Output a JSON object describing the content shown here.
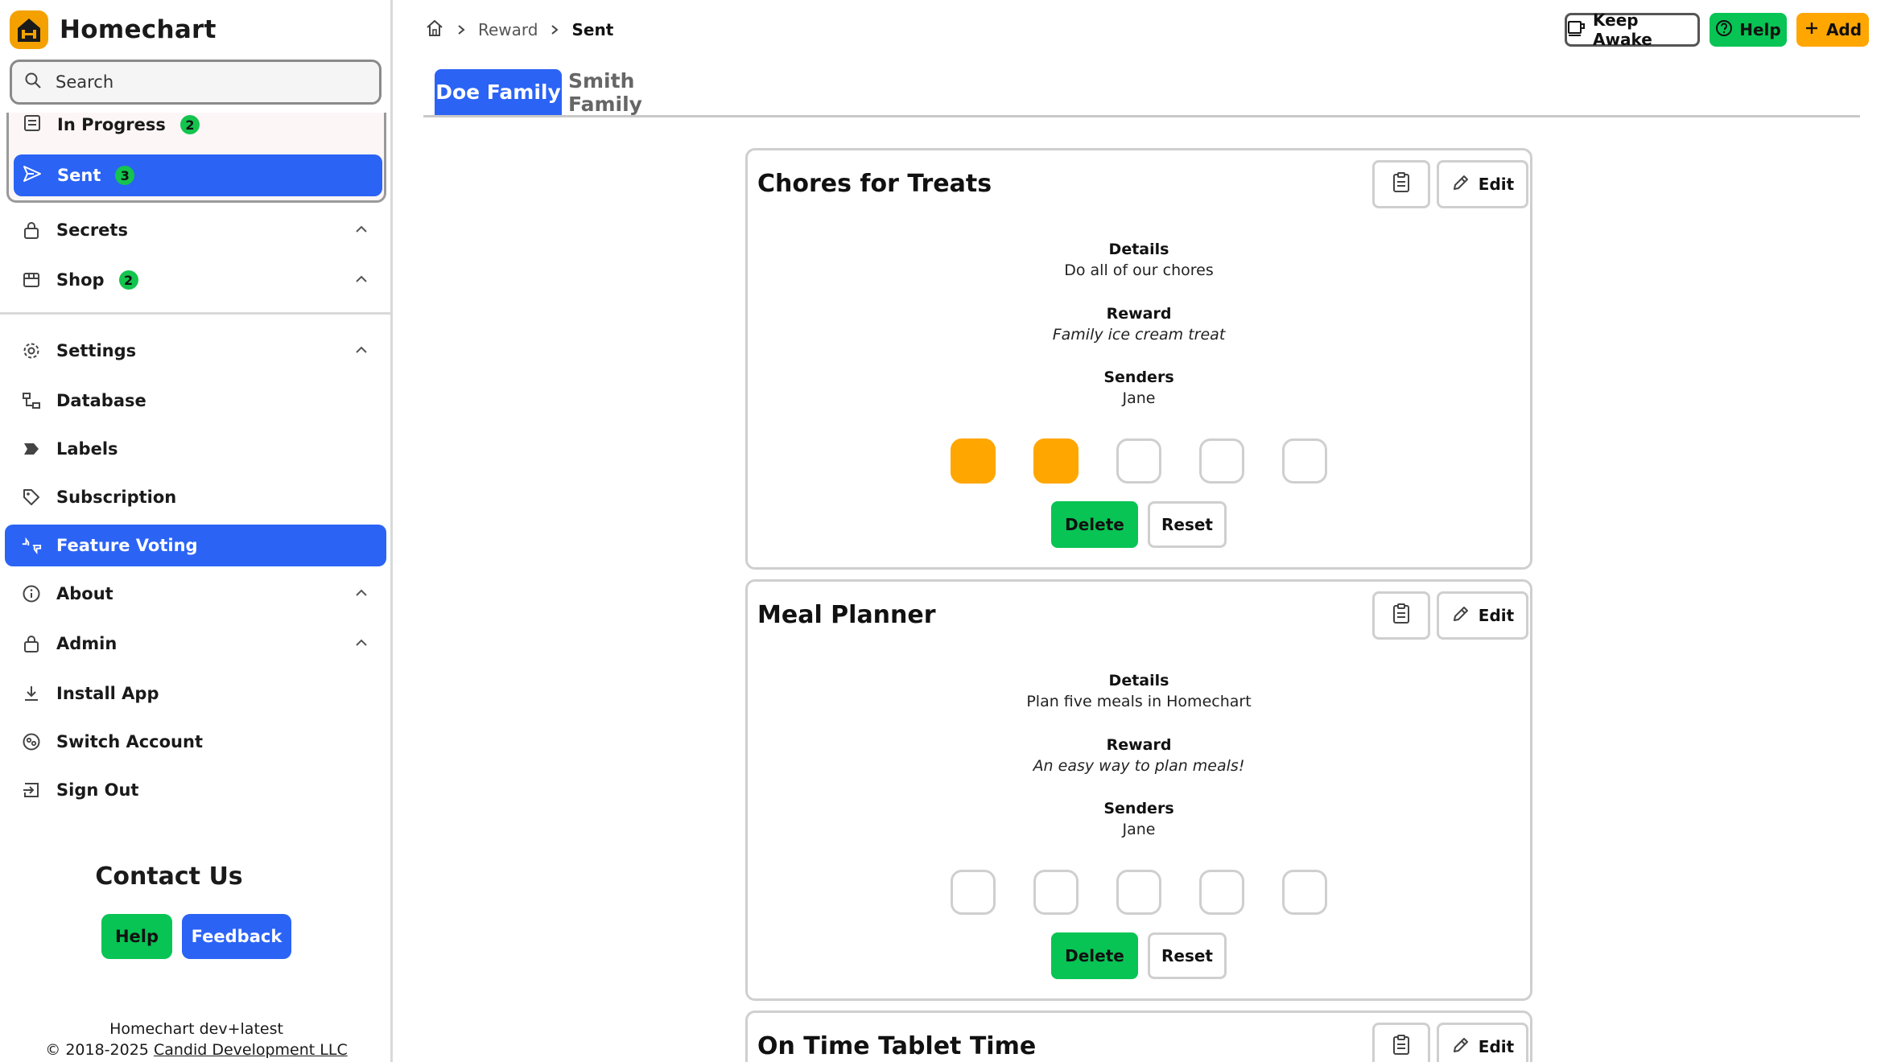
{
  "app": {
    "name": "Homechart",
    "logo_icon": "home-logo-icon",
    "accent": "#2b63f5",
    "warning": "#ffa600",
    "success": "#14c44e"
  },
  "search": {
    "placeholder": "Search"
  },
  "sidebar": {
    "sub_items": [
      {
        "label": "In Progress",
        "badge": "2",
        "icon": "list-icon"
      },
      {
        "label": "Sent",
        "badge": "3",
        "icon": "send-icon",
        "active": true
      }
    ],
    "items": [
      {
        "label": "Secrets",
        "icon": "lock-icon",
        "chevron": true
      },
      {
        "label": "Shop",
        "icon": "store-icon",
        "badge": "2",
        "chevron": true
      },
      {
        "label": "Settings",
        "icon": "gear-icon",
        "chevron": true
      },
      {
        "label": "Database",
        "icon": "database-icon"
      },
      {
        "label": "Labels",
        "icon": "label-icon"
      },
      {
        "label": "Subscription",
        "icon": "tag-icon"
      },
      {
        "label": "Feature Voting",
        "icon": "thumbs-icon",
        "active": true
      },
      {
        "label": "About",
        "icon": "info-icon",
        "chevron": true
      },
      {
        "label": "Admin",
        "icon": "lock-icon",
        "chevron": true
      },
      {
        "label": "Install App",
        "icon": "download-icon"
      },
      {
        "label": "Switch Account",
        "icon": "switch-account-icon"
      },
      {
        "label": "Sign Out",
        "icon": "sign-out-icon"
      }
    ]
  },
  "contact": {
    "title": "Contact Us",
    "help_label": "Help",
    "feedback_label": "Feedback"
  },
  "footer": {
    "version": "Homechart dev+latest",
    "copyright_prefix": "© 2018-2025 ",
    "company": "Candid Development LLC"
  },
  "breadcrumb": {
    "items": [
      "Reward",
      "Sent"
    ]
  },
  "header": {
    "keep_awake_label": "Keep Awake",
    "help_label": "Help",
    "add_label": "Add"
  },
  "tabs": [
    {
      "label": "Doe Family",
      "active": true
    },
    {
      "label": "Smith Family",
      "active": false
    }
  ],
  "cards": [
    {
      "title": "Chores for Treats",
      "edit_label": "Edit",
      "details_label": "Details",
      "details": "Do all of our chores",
      "reward_label": "Reward",
      "reward": "Family ice cream treat",
      "senders_label": "Senders",
      "senders": "Jane",
      "progress": {
        "completed": 2,
        "total": 5
      },
      "delete_label": "Delete",
      "reset_label": "Reset"
    },
    {
      "title": "Meal Planner",
      "edit_label": "Edit",
      "details_label": "Details",
      "details": "Plan five meals in Homechart",
      "reward_label": "Reward",
      "reward": "An easy way to plan meals!",
      "senders_label": "Senders",
      "senders": "Jane",
      "progress": {
        "completed": 0,
        "total": 5
      },
      "delete_label": "Delete",
      "reset_label": "Reset"
    },
    {
      "title": "On Time Tablet Time",
      "edit_label": "Edit"
    }
  ]
}
